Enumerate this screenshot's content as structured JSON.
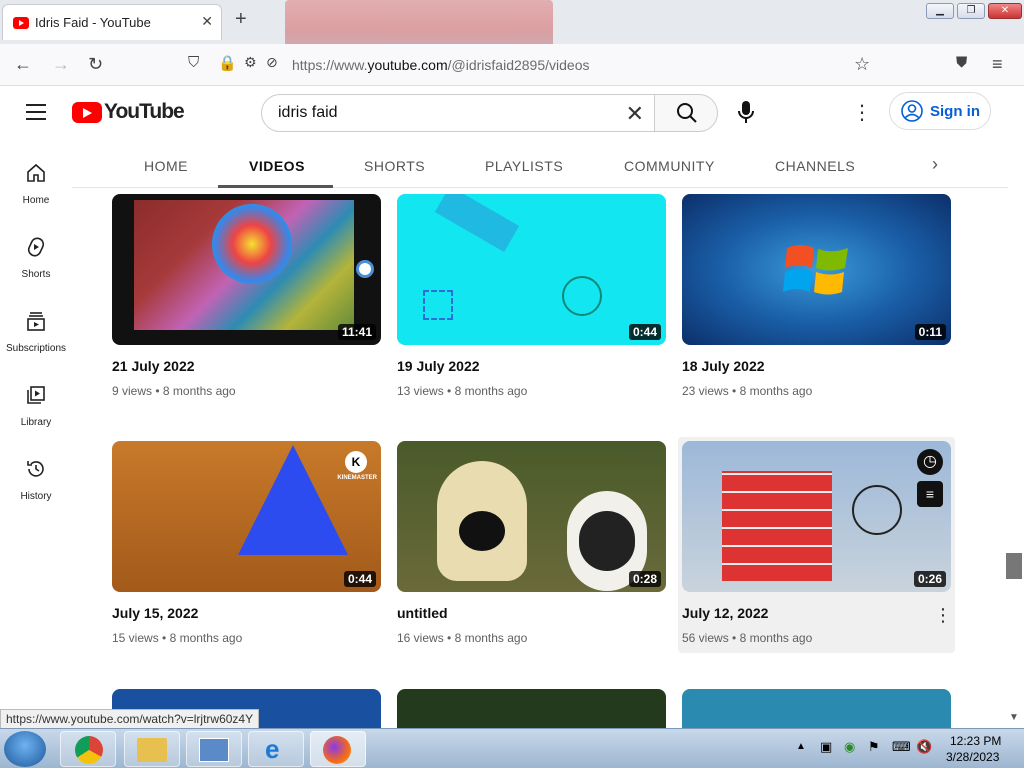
{
  "browser": {
    "tab_title": "Idris Faid - YouTube",
    "url_prefix": "https://www.",
    "url_domain": "youtube.com",
    "url_path": "/@idrisfaid2895/videos",
    "status_url": "https://www.youtube.com/watch?v=lrjtrw60z4Y"
  },
  "header": {
    "logo_text": "YouTube",
    "search_value": "idris  faid",
    "signin_label": "Sign in"
  },
  "sidebar": [
    {
      "label": "Home",
      "icon": "home-icon"
    },
    {
      "label": "Shorts",
      "icon": "shorts-icon"
    },
    {
      "label": "Subscriptions",
      "icon": "subscriptions-icon"
    },
    {
      "label": "Library",
      "icon": "library-icon"
    },
    {
      "label": "History",
      "icon": "history-icon"
    }
  ],
  "channel_tabs": [
    "HOME",
    "VIDEOS",
    "SHORTS",
    "PLAYLISTS",
    "COMMUNITY",
    "CHANNELS"
  ],
  "videos": [
    {
      "title": "21 July 2022",
      "views": "9 views",
      "age": "8 months ago",
      "duration": "11:41"
    },
    {
      "title": "19 July 2022",
      "views": "13 views",
      "age": "8 months ago",
      "duration": "0:44"
    },
    {
      "title": "18 July 2022",
      "views": "23 views",
      "age": "8 months ago",
      "duration": "0:11"
    },
    {
      "title": "July 15, 2022",
      "views": "15 views",
      "age": "8 months ago",
      "duration": "0:44"
    },
    {
      "title": "untitled",
      "views": "16 views",
      "age": "8 months ago",
      "duration": "0:28"
    },
    {
      "title": "July 12, 2022",
      "views": "56 views",
      "age": "8 months ago",
      "duration": "0:26"
    }
  ],
  "taskbar": {
    "time": "12:23 PM",
    "date": "3/28/2023"
  }
}
